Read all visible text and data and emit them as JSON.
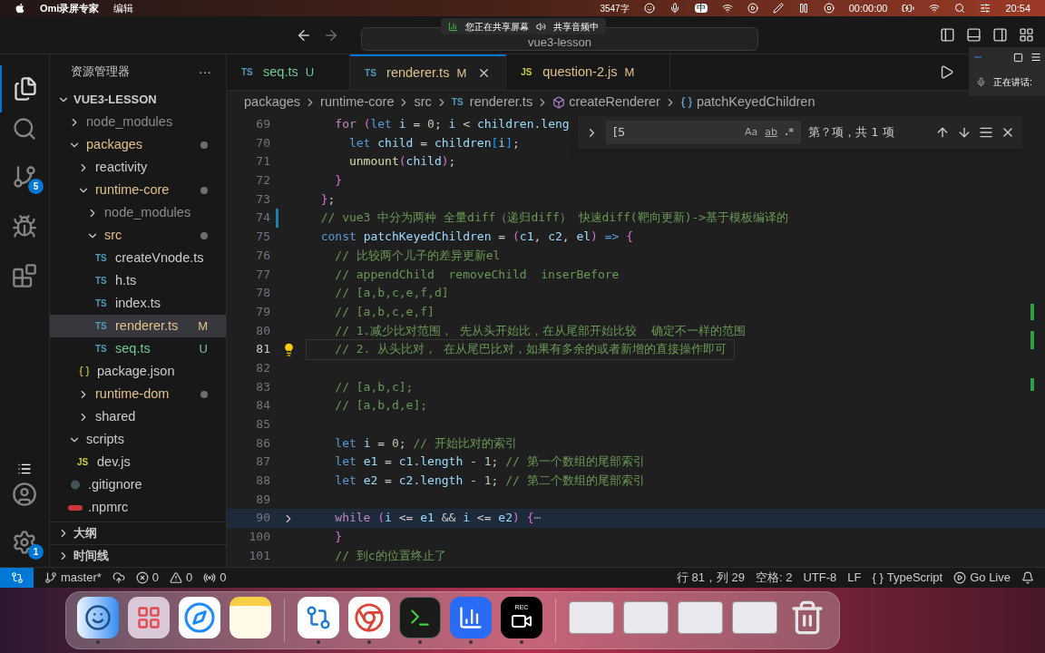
{
  "menubar": {
    "app": "Omi录屏专家",
    "menus": [
      "编辑"
    ],
    "word_count": "3547字",
    "input_method": "中",
    "timer": "00:00:00",
    "clock": "20:54"
  },
  "share_banner": {
    "screen": "您正在共享屏幕",
    "audio": "共享音频中"
  },
  "meeting_panel": {
    "speaking": "正在讲话:"
  },
  "titlebar": {
    "search": "vue3-lesson"
  },
  "activity_bar": {
    "source_control_badge": "5",
    "settings_badge": "1"
  },
  "sidebar": {
    "title": "资源管理器",
    "more": "···",
    "root": "VUE3-LESSON",
    "root_expanded": true,
    "tree": [
      {
        "name": "node_modules",
        "kind": "folder",
        "expanded": false,
        "ignored": true,
        "modified": false,
        "selected": false
      },
      {
        "name": "packages",
        "kind": "folder",
        "expanded": true,
        "modified": true,
        "selected": false,
        "children": [
          {
            "name": "reactivity",
            "kind": "folder",
            "expanded": false,
            "modified": false,
            "selected": false
          },
          {
            "name": "runtime-core",
            "kind": "folder",
            "expanded": true,
            "modified": true,
            "selected": false,
            "children": [
              {
                "name": "node_modules",
                "kind": "folder",
                "expanded": false,
                "ignored": true,
                "modified": false,
                "selected": false
              },
              {
                "name": "src",
                "kind": "folder",
                "expanded": true,
                "modified": true,
                "selected": false,
                "children": [
                  {
                    "name": "createVnode.ts",
                    "kind": "file",
                    "icon": "TS",
                    "selected": false
                  },
                  {
                    "name": "h.ts",
                    "kind": "file",
                    "icon": "TS",
                    "selected": false
                  },
                  {
                    "name": "index.ts",
                    "kind": "file",
                    "icon": "TS",
                    "selected": false
                  },
                  {
                    "name": "renderer.ts",
                    "kind": "file",
                    "icon": "TS",
                    "status": "M",
                    "selected": true
                  },
                  {
                    "name": "seq.ts",
                    "kind": "file",
                    "icon": "TS",
                    "status": "U",
                    "selected": false
                  }
                ]
              }
            ]
          },
          {
            "name": "package.json",
            "kind": "json",
            "selected": false
          },
          {
            "name": "runtime-dom",
            "kind": "folder",
            "expanded": false,
            "modified": true,
            "selected": false
          },
          {
            "name": "shared",
            "kind": "folder",
            "expanded": false,
            "modified": false,
            "selected": false
          }
        ]
      },
      {
        "name": "scripts",
        "kind": "folder",
        "expanded": true,
        "modified": false,
        "selected": false,
        "children": [
          {
            "name": "dev.js",
            "kind": "file",
            "icon": "JS",
            "selected": false
          }
        ]
      },
      {
        "name": ".gitignore",
        "kind": "git",
        "selected": false
      },
      {
        "name": ".npmrc",
        "kind": "npm",
        "selected": false
      }
    ],
    "sections": [
      {
        "label": "大纲",
        "expanded": false
      },
      {
        "label": "时间线",
        "expanded": false
      }
    ]
  },
  "tabs": [
    {
      "label": "seq.ts",
      "icon": "TS",
      "status": "U",
      "selected": false
    },
    {
      "label": "renderer.ts",
      "icon": "TS",
      "status": "M",
      "selected": true
    },
    {
      "label": "question-2.js",
      "icon": "JS",
      "status": "M",
      "selected": false
    }
  ],
  "breadcrumbs": [
    {
      "label": "packages",
      "kind": "folder"
    },
    {
      "label": "runtime-core",
      "kind": "folder"
    },
    {
      "label": "src",
      "kind": "folder"
    },
    {
      "label": "renderer.ts",
      "kind": "file",
      "icon": "TS"
    },
    {
      "label": "createRenderer",
      "kind": "method"
    },
    {
      "label": "patchKeyedChildren",
      "kind": "variable"
    }
  ],
  "find_widget": {
    "value": "[5",
    "match_case": "Aa",
    "whole_word": "ab",
    "regex": ".*",
    "result": "第？项，共 1 项"
  },
  "code": [
    {
      "n": "69",
      "text": "    for (let i = 0; i < children.leng"
    },
    {
      "n": "70",
      "text": "      let child = children[i];"
    },
    {
      "n": "71",
      "text": "      unmount(child);"
    },
    {
      "n": "72",
      "text": "    }"
    },
    {
      "n": "73",
      "text": "  };"
    },
    {
      "n": "74",
      "changed": true,
      "text": "  // vue3 中分为两种 全量diff（递归diff） 快速diff(靶向更新)->基于模板编译的"
    },
    {
      "n": "75",
      "text": "  const patchKeyedChildren = (c1, c2, el) => {"
    },
    {
      "n": "76",
      "text": "    // 比较两个儿子的差异更新el"
    },
    {
      "n": "77",
      "text": "    // appendChild  removeChild  inserBefore"
    },
    {
      "n": "78",
      "text": "    // [a,b,c,e,f,d]"
    },
    {
      "n": "79",
      "text": "    // [a,b,c,e,f]"
    },
    {
      "n": "80",
      "text": "    // 1.减少比对范围， 先从头开始比，在从尾部开始比较  确定不一样的范围"
    },
    {
      "n": "81",
      "current": true,
      "lightbulb": true,
      "text": "    // 2. 从头比对， 在从尾巴比对，如果有多余的或者新增的直接操作即可"
    },
    {
      "n": "82"
    },
    {
      "n": "83",
      "text": "    // [a,b,c];"
    },
    {
      "n": "84",
      "text": "    // [a,b,d,e];"
    },
    {
      "n": "85"
    },
    {
      "n": "86",
      "text": "    let i = 0; // 开始比对的索引"
    },
    {
      "n": "87",
      "text": "    let e1 = c1.length - 1; // 第一个数组的尾部索引"
    },
    {
      "n": "88",
      "text": "    let e2 = c2.length - 1; // 第二个数组的尾部索引"
    },
    {
      "n": "89"
    },
    {
      "n": "90",
      "folded": true,
      "text": "    while (i <= e1 && i <= e2) {⋯"
    },
    {
      "n": "100",
      "text": "    }"
    },
    {
      "n": "101",
      "text": "    // 到c的位置终止了"
    }
  ],
  "status_bar": {
    "branch": "master*",
    "errors": "0",
    "warnings": "0",
    "ports": "0",
    "position": "行 81，列 29",
    "indent": "空格: 2",
    "encoding": "UTF-8",
    "eol": "LF",
    "braces": "{ }",
    "language": "TypeScript",
    "live": "Go Live"
  },
  "dock": {
    "recorder_label": "REC",
    "apps": [
      {
        "kind": "finder",
        "running": true
      },
      {
        "kind": "launchpad",
        "running": false
      },
      {
        "kind": "safari",
        "running": false
      },
      {
        "kind": "notes",
        "running": false
      },
      {
        "kind": "separator"
      },
      {
        "kind": "vscode",
        "running": true
      },
      {
        "kind": "chrome",
        "running": true
      },
      {
        "kind": "terminal",
        "running": true
      },
      {
        "kind": "lark",
        "running": true
      },
      {
        "kind": "recorder",
        "running": true
      },
      {
        "kind": "separator"
      },
      {
        "kind": "window",
        "running": false
      },
      {
        "kind": "window",
        "running": false
      },
      {
        "kind": "window",
        "running": false
      },
      {
        "kind": "window",
        "running": false
      },
      {
        "kind": "trash",
        "running": false
      }
    ]
  }
}
